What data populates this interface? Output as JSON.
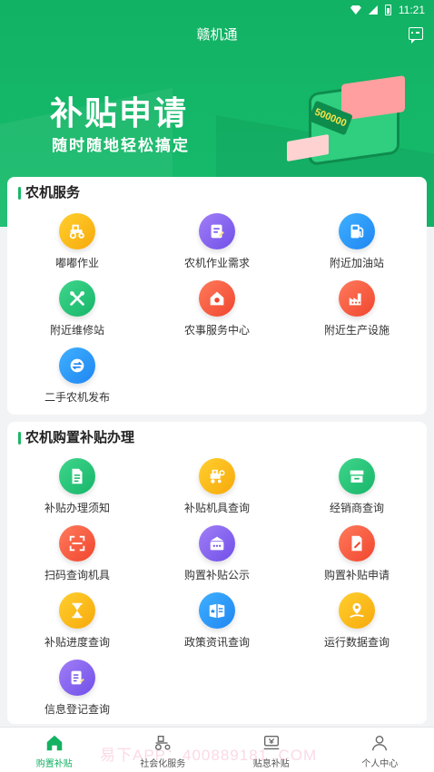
{
  "statusbar": {
    "time": "11:21"
  },
  "header": {
    "title": "赣机通",
    "message_icon": "message-icon"
  },
  "banner": {
    "title": "补贴申请",
    "subtitle": "随时随地轻松搞定",
    "machine_label": "500000"
  },
  "section1": {
    "title": "农机服务",
    "items": [
      {
        "label": "嘟嘟作业",
        "icon": "tractor-icon",
        "color": "#f7b21a"
      },
      {
        "label": "农机作业需求",
        "icon": "form-edit-icon",
        "color": "#8a63f3"
      },
      {
        "label": "附近加油站",
        "icon": "fuel-pump-icon",
        "color": "#2b9bfa"
      },
      {
        "label": "附近维修站",
        "icon": "wrench-icon",
        "color": "#25c57a"
      },
      {
        "label": "农事服务中心",
        "icon": "house-icon",
        "color": "#f65d3f"
      },
      {
        "label": "附近生产设施",
        "icon": "factory-icon",
        "color": "#f65d3f"
      },
      {
        "label": "二手农机发布",
        "icon": "exchange-icon",
        "color": "#2b9bfa"
      }
    ]
  },
  "section2": {
    "title": "农机购置补贴办理",
    "items": [
      {
        "label": "补贴办理须知",
        "icon": "document-icon",
        "color": "#25c57a"
      },
      {
        "label": "补贴机具查询",
        "icon": "machine-search-icon",
        "color": "#f7b21a"
      },
      {
        "label": "经销商查询",
        "icon": "store-icon",
        "color": "#25c57a"
      },
      {
        "label": "扫码查询机具",
        "icon": "scan-icon",
        "color": "#f65d3f"
      },
      {
        "label": "购置补贴公示",
        "icon": "notice-board-icon",
        "color": "#8a63f3"
      },
      {
        "label": "购置补贴申请",
        "icon": "apply-edit-icon",
        "color": "#f65d3f"
      },
      {
        "label": "补贴进度查询",
        "icon": "hourglass-icon",
        "color": "#f7b21a"
      },
      {
        "label": "政策资讯查询",
        "icon": "news-icon",
        "color": "#2b9bfa"
      },
      {
        "label": "运行数据查询",
        "icon": "location-data-icon",
        "color": "#f7b21a"
      },
      {
        "label": "信息登记查询",
        "icon": "register-icon",
        "color": "#8a63f3"
      }
    ]
  },
  "tabbar": {
    "items": [
      {
        "label": "购置补贴",
        "icon": "home-icon",
        "active": true
      },
      {
        "label": "社会化服务",
        "icon": "tractor-outline-icon",
        "active": false
      },
      {
        "label": "贴息补贴",
        "icon": "subsidy-icon",
        "active": false
      },
      {
        "label": "个人中心",
        "icon": "person-icon",
        "active": false
      }
    ]
  },
  "watermark": "易下APP：400889181 .COM"
}
